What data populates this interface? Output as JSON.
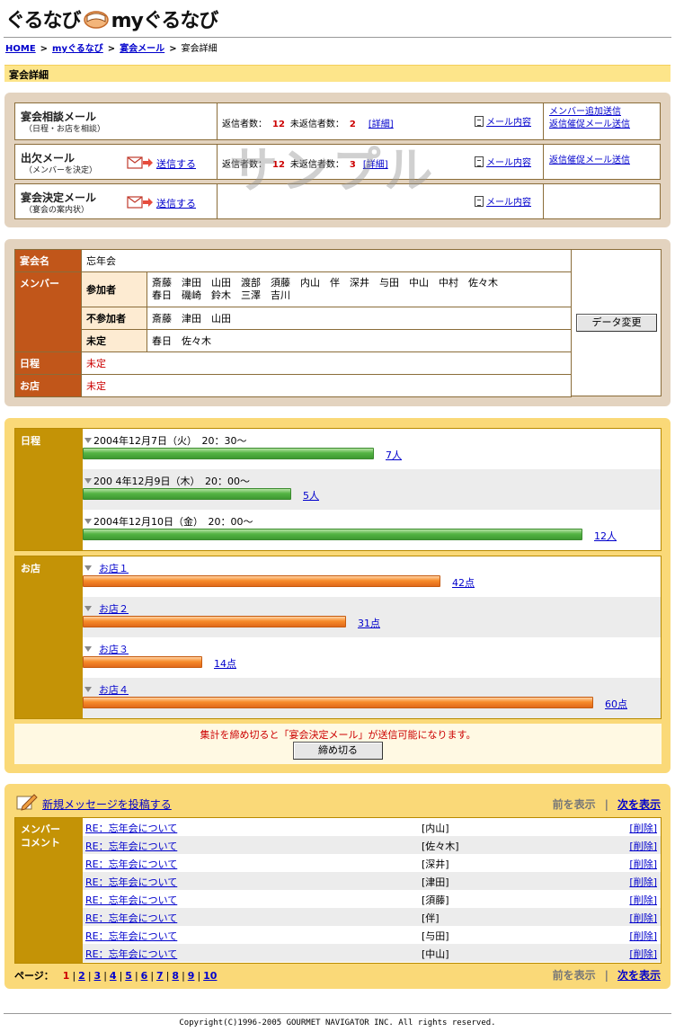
{
  "header": {
    "logo_left": "ぐるなび",
    "logo_right": "myぐるなび"
  },
  "breadcrumb": {
    "home": "HOME",
    "my": "myぐるなび",
    "mail": "宴会メール",
    "current": "宴会詳細"
  },
  "page_title": "宴会詳細",
  "mails": {
    "watermark": "サンプル",
    "consult": {
      "title": "宴会相談メール",
      "sub": "（日程・お店を相談）",
      "replied_label": "返信者数：",
      "replied": "12",
      "unreplied_label": "未返信者数：",
      "unreplied": "2",
      "detail": "[詳細]",
      "content_link": "メール内容",
      "action1": "メンバー追加送信",
      "action2": "返信催促メール送信"
    },
    "attendance": {
      "title": "出欠メール",
      "sub": "（メンバーを決定）",
      "send": "送信する",
      "replied_label": "返信者数：",
      "replied": "12",
      "unreplied_label": "未返信者数：",
      "unreplied": "3",
      "detail": "[詳細]",
      "content_link": "メール内容",
      "action1": "返信催促メール送信"
    },
    "decision": {
      "title": "宴会決定メール",
      "sub": "（宴会の案内状）",
      "send": "送信する",
      "content_link": "メール内容"
    }
  },
  "info": {
    "name_label": "宴会名",
    "name": "忘年会",
    "member_label": "メンバー",
    "attend_label": "参加者",
    "attend_line1": "斎藤　津田　山田　渡部　須藤　内山　伴　深井　与田　中山　中村　佐々木",
    "attend_line2": "春日　磯崎　鈴木　三澤　吉川",
    "absent_label": "不参加者",
    "absent": "斎藤　津田　山田",
    "undecided_label": "未定",
    "undecided": "春日　佐々木",
    "date_label": "日程",
    "date_value": "未定",
    "shop_label": "お店",
    "shop_value": "未定",
    "edit_button": "データ変更"
  },
  "vote": {
    "date_label": "日程",
    "shop_label": "お店",
    "dates": [
      {
        "label": "2004年12月7日（火）　20：30〜",
        "count": "7人",
        "value": 7
      },
      {
        "label": "200 4年12月9日（木）　20：00〜",
        "count": "5人",
        "value": 5
      },
      {
        "label": "2004年12月10日（金）　20：00〜",
        "count": "12人",
        "value": 12
      }
    ],
    "shops": [
      {
        "label": "お店１",
        "score": "42点",
        "value": 42
      },
      {
        "label": "お店２",
        "score": "31点",
        "value": 31
      },
      {
        "label": "お店３",
        "score": "14点",
        "value": 14
      },
      {
        "label": "お店４",
        "score": "60点",
        "value": 60
      }
    ],
    "close_message": "集計を締め切ると「宴会決定メール」が送信可能になります。",
    "close_button": "締め切る"
  },
  "messages": {
    "post_link": "新規メッセージを投稿する",
    "prev": "前を表示",
    "separator": "|",
    "next": "次を表示",
    "section_label_1": "メンバー",
    "section_label_2": "コメント",
    "rows": [
      {
        "subject": "RE：忘年会について",
        "author": "[内山]",
        "delete": "[削除]"
      },
      {
        "subject": "RE：忘年会について",
        "author": "[佐々木]",
        "delete": "[削除]"
      },
      {
        "subject": "RE：忘年会について",
        "author": "[深井]",
        "delete": "[削除]"
      },
      {
        "subject": "RE：忘年会について",
        "author": "[津田]",
        "delete": "[削除]"
      },
      {
        "subject": "RE：忘年会について",
        "author": "[須藤]",
        "delete": "[削除]"
      },
      {
        "subject": "RE：忘年会について",
        "author": "[伴]",
        "delete": "[削除]"
      },
      {
        "subject": "RE：忘年会について",
        "author": "[与田]",
        "delete": "[削除]"
      },
      {
        "subject": "RE：忘年会について",
        "author": "[中山]",
        "delete": "[削除]"
      }
    ],
    "page_label": "ページ：",
    "current_page": "1",
    "pages": [
      "2",
      "3",
      "4",
      "5",
      "6",
      "7",
      "8",
      "9",
      "10"
    ]
  },
  "copyright": "Copyright(C)1996-2005 GOURMET NAVIGATOR INC. All rights reserved.",
  "colors": {
    "accent_brown": "#c1561a",
    "gold": "#c49306",
    "panel_tan": "#e3d3bf",
    "panel_yellow": "#fad978",
    "bar_green": "#54b443",
    "bar_orange": "#f78b2a",
    "alert_red": "#cc0000"
  }
}
